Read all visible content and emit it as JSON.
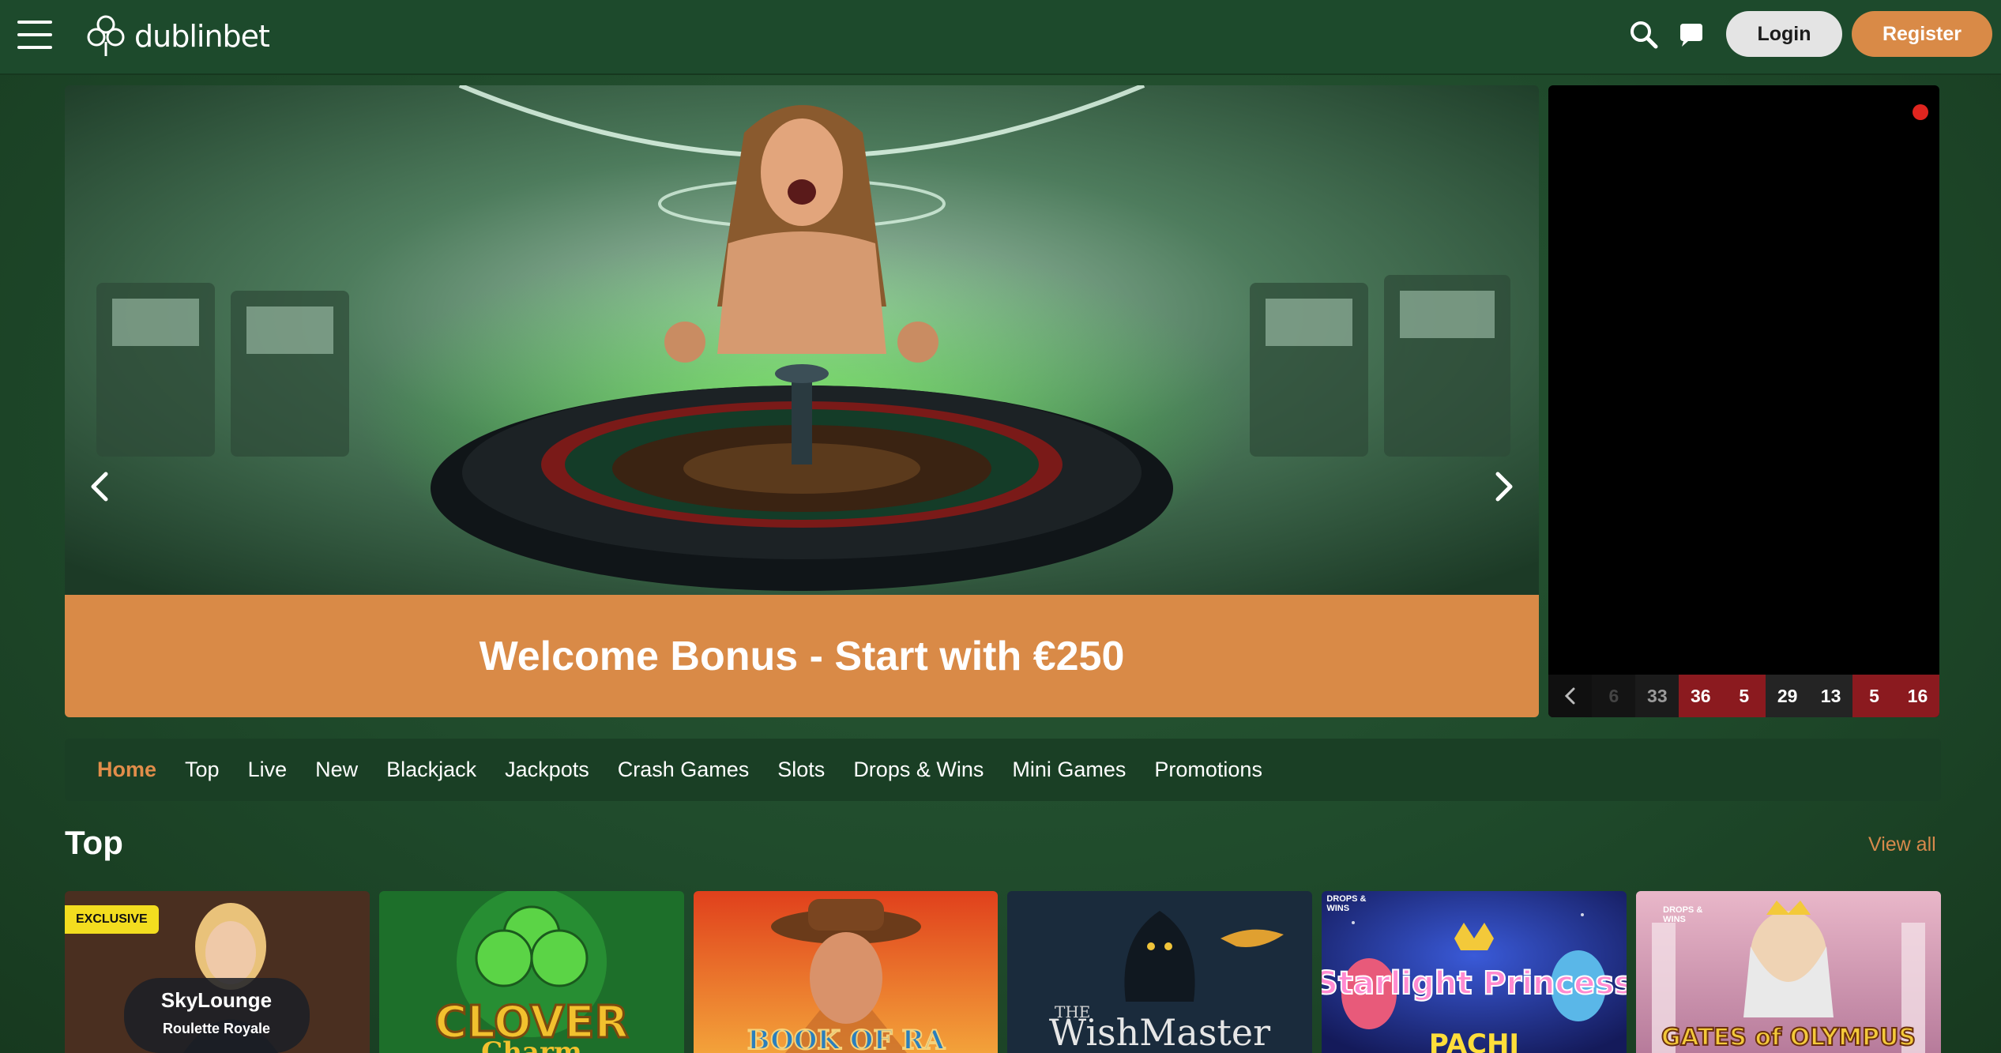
{
  "header": {
    "logo_text": "dublinbet",
    "login_label": "Login",
    "register_label": "Register",
    "icons": [
      "menu-icon",
      "search-icon",
      "chat-icon"
    ]
  },
  "banner": {
    "headline": "Welcome Bonus - Start with €250"
  },
  "live_results": [
    {
      "value": "6",
      "color": "faded"
    },
    {
      "value": "33",
      "color": "black"
    },
    {
      "value": "36",
      "color": "red"
    },
    {
      "value": "5",
      "color": "red"
    },
    {
      "value": "29",
      "color": "black"
    },
    {
      "value": "13",
      "color": "black"
    },
    {
      "value": "5",
      "color": "red"
    },
    {
      "value": "16",
      "color": "red"
    }
  ],
  "categories": [
    {
      "label": "Home",
      "active": true
    },
    {
      "label": "Top",
      "active": false
    },
    {
      "label": "Live",
      "active": false
    },
    {
      "label": "New",
      "active": false
    },
    {
      "label": "Blackjack",
      "active": false
    },
    {
      "label": "Jackpots",
      "active": false
    },
    {
      "label": "Crash Games",
      "active": false
    },
    {
      "label": "Slots",
      "active": false
    },
    {
      "label": "Drops & Wins",
      "active": false
    },
    {
      "label": "Mini Games",
      "active": false
    },
    {
      "label": "Promotions",
      "active": false
    }
  ],
  "section": {
    "title": "Top",
    "view_all": "View all"
  },
  "games": [
    {
      "name": "SkyLounge",
      "subtitle": "Roulette Royale",
      "badge": "EXCLUSIVE"
    },
    {
      "name": "CLOVER",
      "subtitle": "Charm"
    },
    {
      "name": "BOOK OF RA",
      "subtitle": ""
    },
    {
      "name": "WishMaster",
      "subtitle": "THE"
    },
    {
      "name": "Starlight Princess",
      "subtitle": "PACHI",
      "badge": "DROPS & WINS"
    },
    {
      "name": "GATES of OLYMPUS",
      "subtitle": "",
      "badge": "DROPS & WINS"
    }
  ],
  "colors": {
    "header_bg": "#1d4a2c",
    "accent": "#d98a47",
    "nav_bg": "#1a3f25",
    "red_number": "#8b1a1f",
    "black_number": "#242424"
  }
}
